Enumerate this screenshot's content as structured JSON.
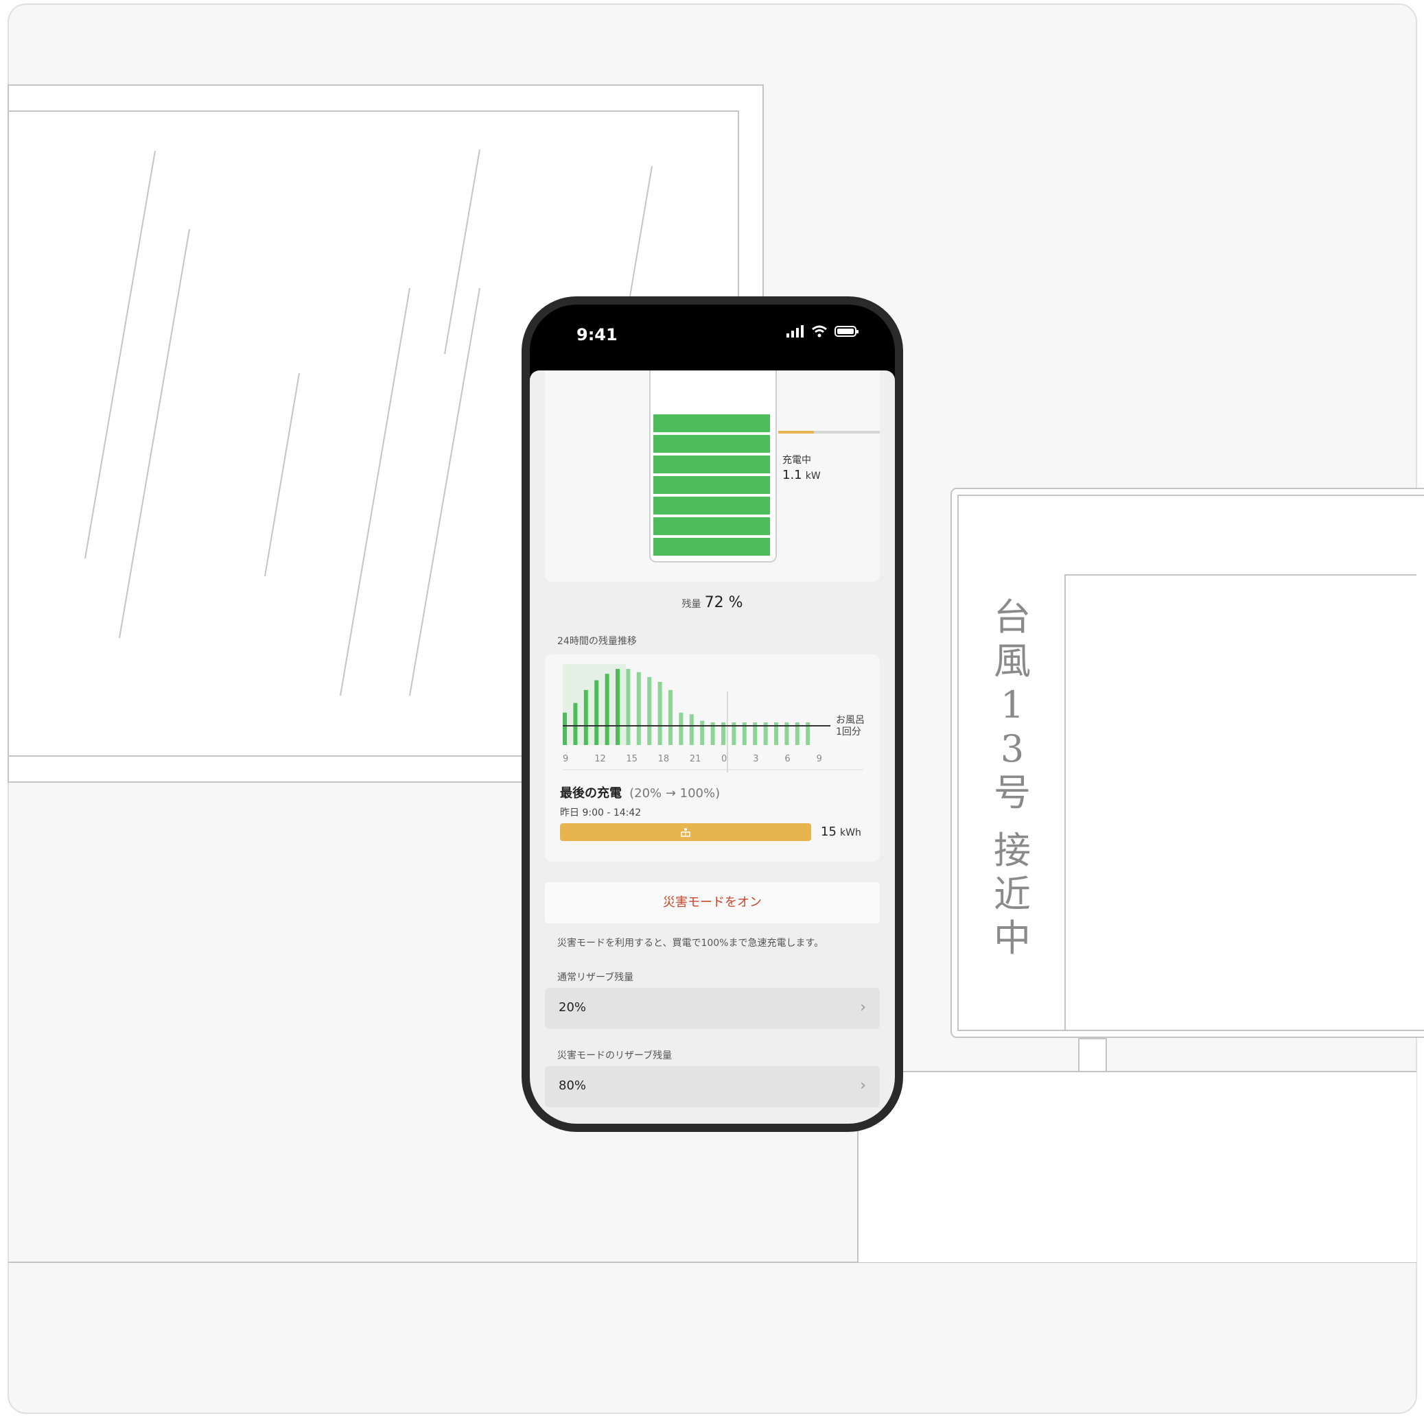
{
  "status_bar": {
    "time": "9:41"
  },
  "battery": {
    "charging_label": "充電中",
    "power_value": "1.1",
    "power_unit": "kW",
    "remaining_label": "残量",
    "remaining_value": "72 %",
    "charge_progress": 0.35
  },
  "history": {
    "title": "24時間の残量推移",
    "annotation_line1": "お風呂",
    "annotation_line2": "1回分"
  },
  "chart_data": {
    "type": "bar",
    "title": "24時間の残量推移",
    "x_tick_labels": [
      "9",
      "12",
      "15",
      "18",
      "21",
      "0",
      "3",
      "6",
      "9"
    ],
    "values": [
      40,
      52,
      68,
      80,
      88,
      94,
      94,
      90,
      84,
      78,
      68,
      40,
      38,
      30,
      28,
      28,
      28,
      28,
      28,
      28,
      28,
      28,
      28,
      28
    ],
    "ylim": [
      0,
      100
    ],
    "reference_line_value": 25,
    "reference_label": "お風呂 1回分"
  },
  "last_charge": {
    "title": "最後の充電",
    "range": "(20% → 100%)",
    "time": "昨日 9:00 - 14:42",
    "energy_value": "15",
    "energy_unit": "kWh"
  },
  "disaster": {
    "button_label": "災害モードをオン",
    "description": "災害モードを利用すると、買電で100%まで急速充電します。"
  },
  "reserve": {
    "normal_label": "通常リザーブ残量",
    "normal_value": "20%",
    "disaster_label": "災害モードのリザーブ残量",
    "disaster_value": "80%"
  },
  "sign": {
    "text": [
      "台",
      "風",
      "1",
      "3",
      "号",
      "",
      "接",
      "近",
      "中"
    ]
  },
  "colors": {
    "green": "#4dbd5c",
    "orange": "#e8b44f",
    "red": "#c8462a",
    "line": "#c4c4c4"
  }
}
